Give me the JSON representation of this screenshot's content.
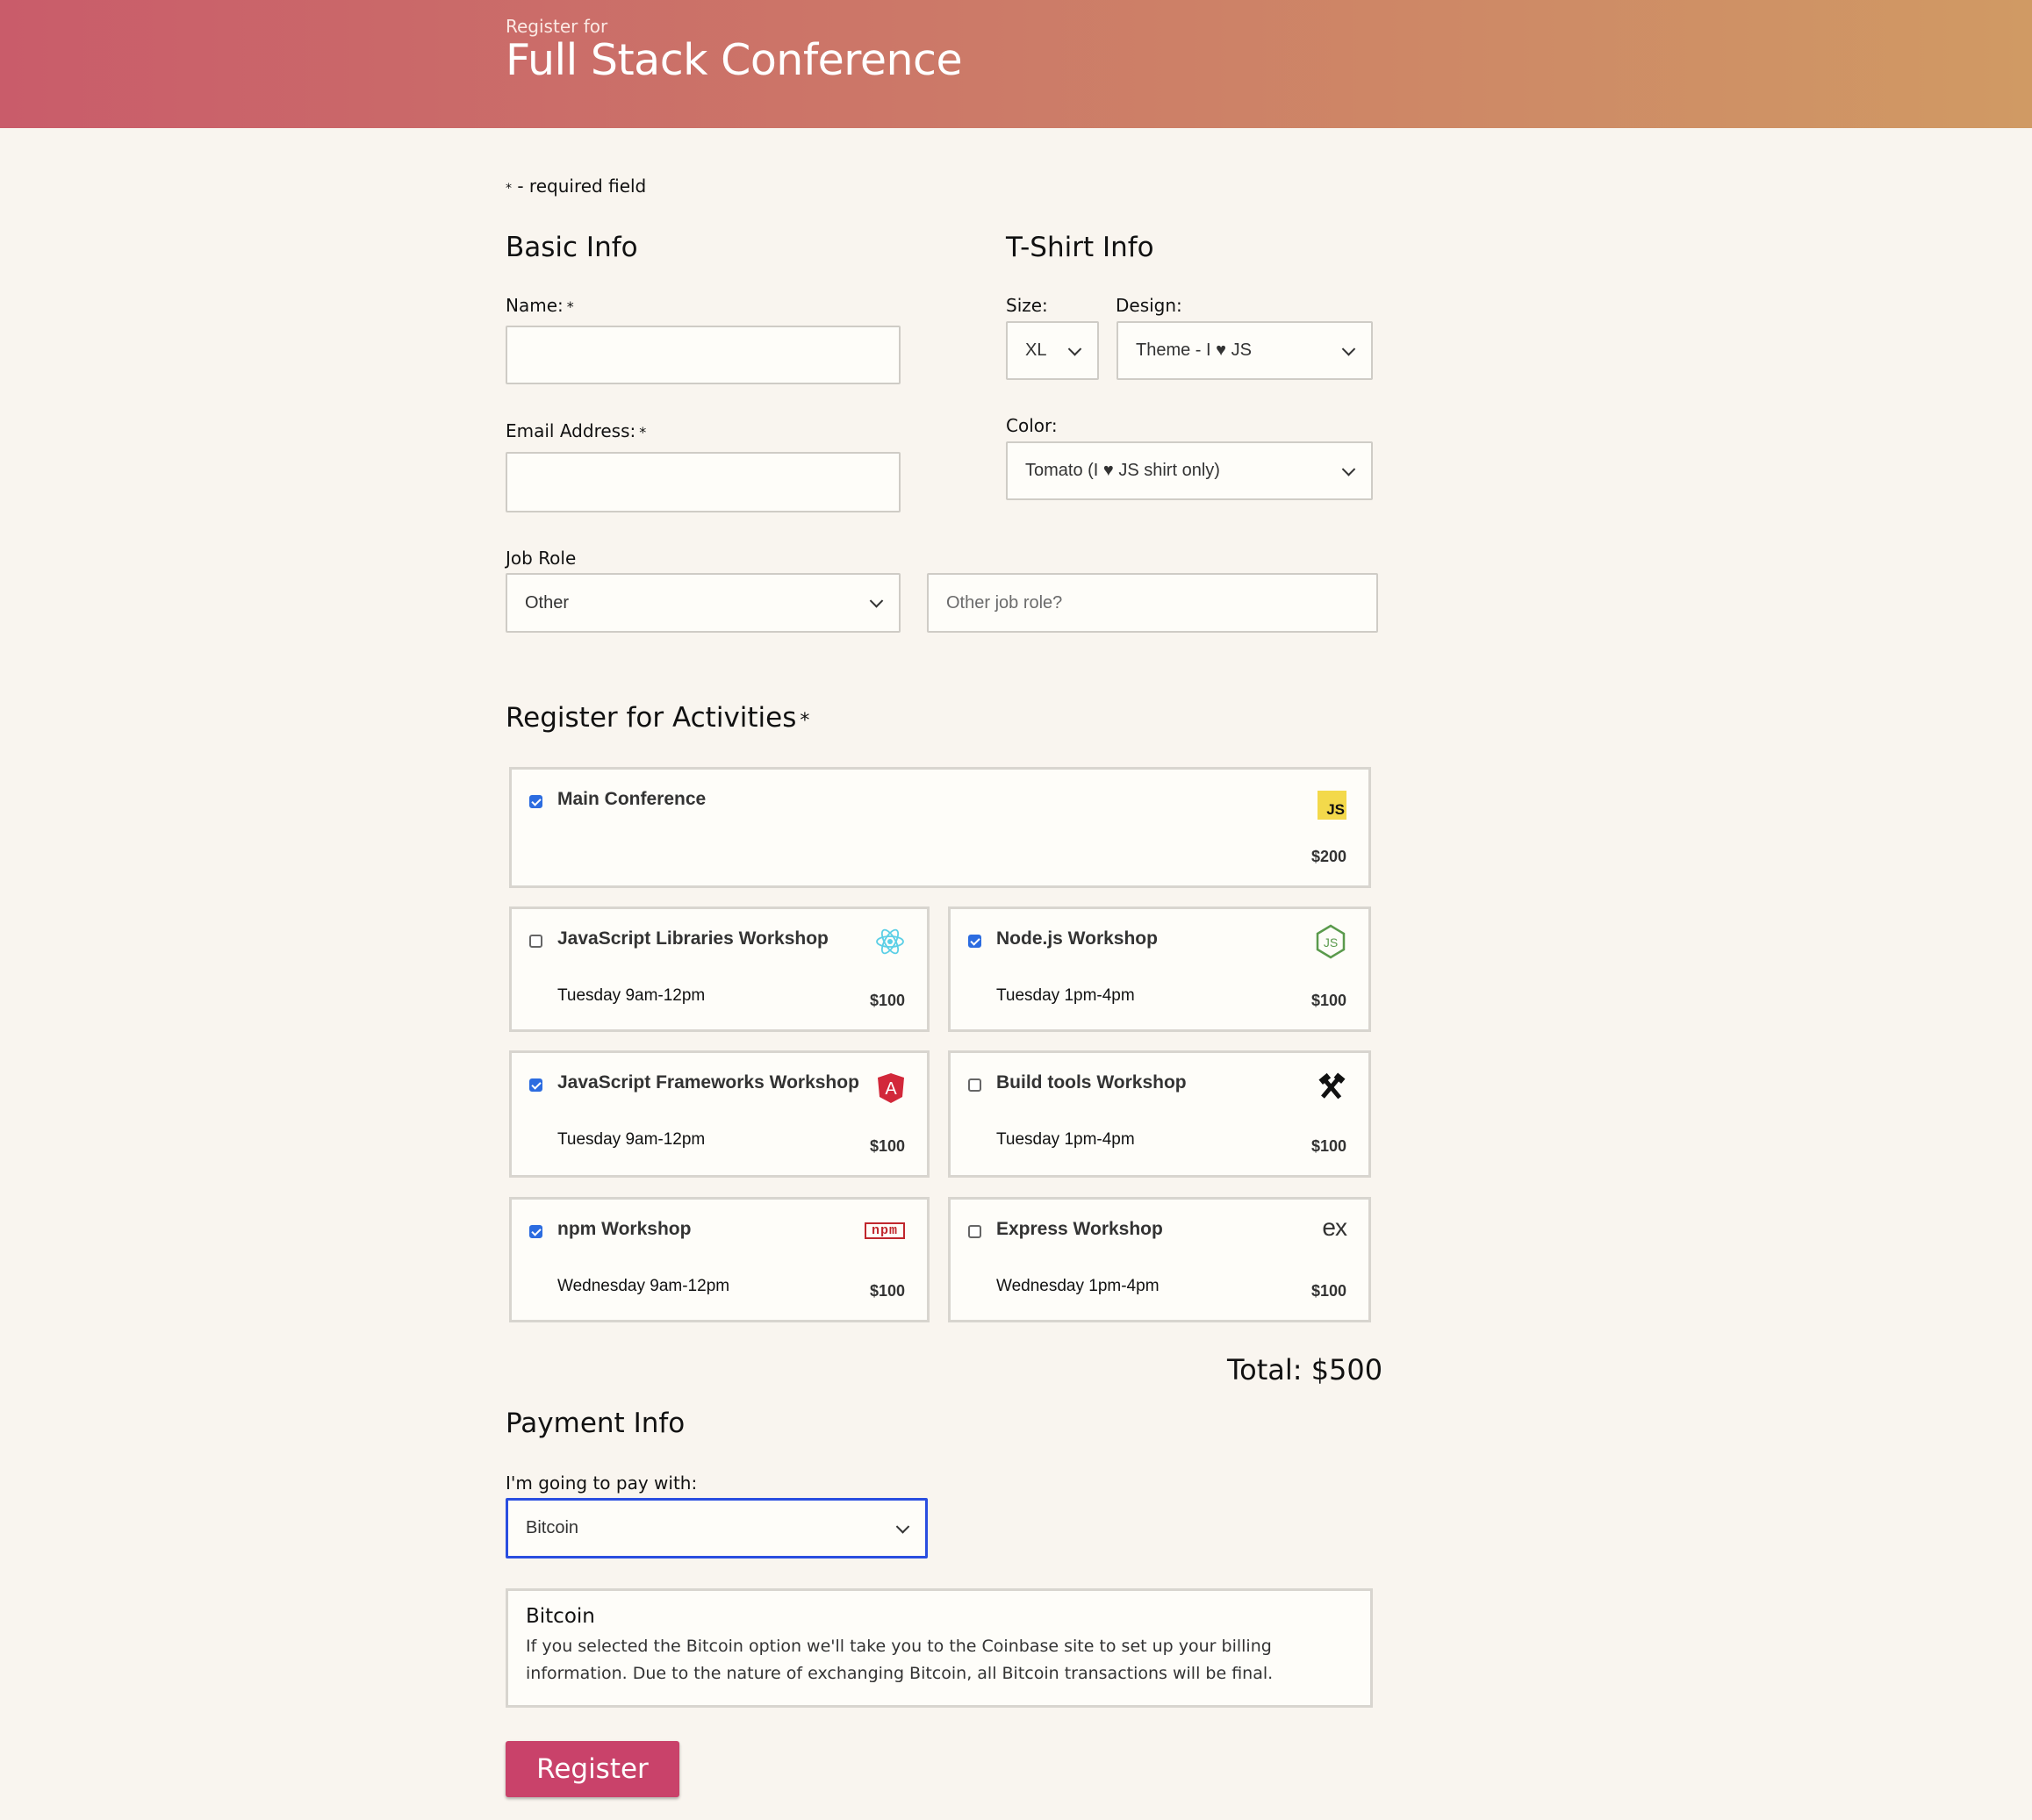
{
  "header": {
    "subtitle": "Register for",
    "title": "Full Stack Conference"
  },
  "required_note": "- required field",
  "required_star": "*",
  "basic_info": {
    "heading": "Basic Info",
    "name_label": "Name:",
    "email_label": "Email Address:",
    "job_role_label": "Job Role",
    "job_role_value": "Other",
    "other_job_placeholder": "Other job role?"
  },
  "tshirt": {
    "heading": "T-Shirt Info",
    "size_label": "Size:",
    "size_value": "XL",
    "design_label": "Design:",
    "design_value": "Theme - I ♥ JS",
    "color_label": "Color:",
    "color_value": "Tomato (I ♥ JS shirt only)"
  },
  "activities": {
    "heading": "Register for Activities",
    "items": [
      {
        "name": "Main Conference",
        "time": "",
        "price": "$200",
        "checked": true,
        "icon": "js-logo-icon"
      },
      {
        "name": "JavaScript Libraries Workshop",
        "time": "Tuesday 9am-12pm",
        "price": "$100",
        "checked": false,
        "icon": "react-logo-icon"
      },
      {
        "name": "Node.js Workshop",
        "time": "Tuesday 1pm-4pm",
        "price": "$100",
        "checked": true,
        "icon": "nodejs-logo-icon"
      },
      {
        "name": "JavaScript Frameworks Workshop",
        "time": "Tuesday 9am-12pm",
        "price": "$100",
        "checked": true,
        "icon": "angular-logo-icon"
      },
      {
        "name": "Build tools Workshop",
        "time": "Tuesday 1pm-4pm",
        "price": "$100",
        "checked": false,
        "icon": "tools-icon"
      },
      {
        "name": "npm Workshop",
        "time": "Wednesday 9am-12pm",
        "price": "$100",
        "checked": true,
        "icon": "npm-logo-icon"
      },
      {
        "name": "Express Workshop",
        "time": "Wednesday 1pm-4pm",
        "price": "$100",
        "checked": false,
        "icon": "express-logo-icon"
      }
    ],
    "total": "Total: $500"
  },
  "payment": {
    "heading": "Payment Info",
    "pay_label": "I'm going to pay with:",
    "method_value": "Bitcoin",
    "box_title": "Bitcoin",
    "box_text": "If you selected the Bitcoin option we'll take you to the Coinbase site to set up your billing information. Due to the nature of exchanging Bitcoin, all Bitcoin transactions will be final."
  },
  "icon_text": {
    "js": "JS",
    "node": "JS",
    "angular": "A",
    "npm": "npm",
    "express": "ex"
  },
  "submit_label": "Register",
  "colors": {
    "accent": "#c9426a",
    "checkbox": "#2c6ce0",
    "focus": "#2a4ee0"
  }
}
